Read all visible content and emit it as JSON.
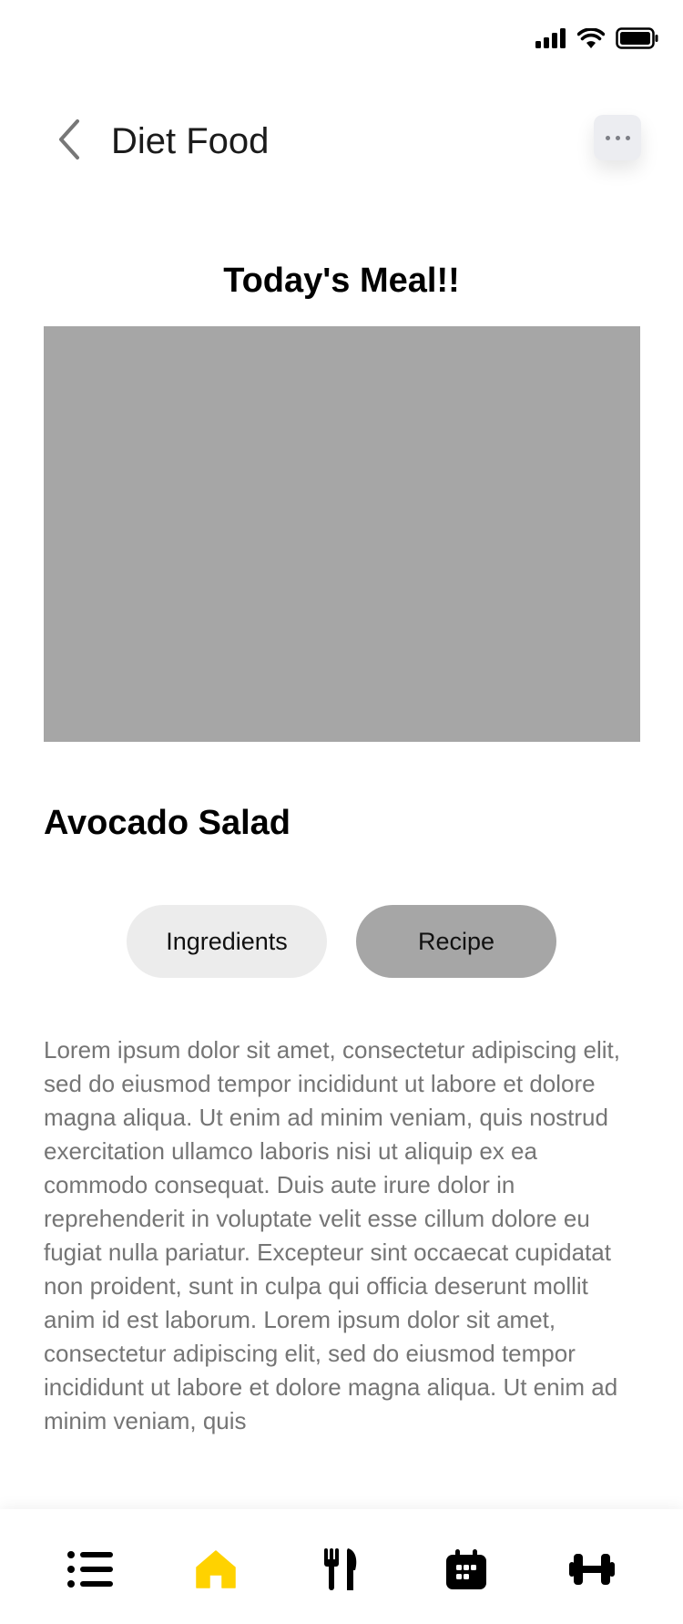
{
  "status_bar": {
    "icons": [
      "signal-icon",
      "wifi-icon",
      "battery-icon"
    ]
  },
  "header": {
    "title": "Diet Food",
    "back_icon": "chevron-left-icon",
    "more_icon": "more-icon"
  },
  "section": {
    "heading": "Today's Meal!!"
  },
  "meal": {
    "name": "Avocado Salad",
    "image_color": "#a6a6a6"
  },
  "tabs": [
    {
      "label": "Ingredients",
      "active": false
    },
    {
      "label": "Recipe",
      "active": true
    }
  ],
  "description": "Lorem ipsum dolor sit amet, consectetur adipiscing elit, sed do eiusmod tempor incididunt ut labore et dolore magna aliqua. Ut enim ad minim veniam, quis nostrud exercitation ullamco laboris nisi ut aliquip ex ea commodo consequat. Duis aute irure dolor in reprehenderit in voluptate velit esse cillum dolore eu fugiat nulla pariatur. Excepteur sint occaecat cupidatat non proident, sunt in culpa qui officia deserunt mollit anim id est laborum. Lorem ipsum dolor sit amet, consectetur adipiscing elit, sed do eiusmod tempor incididunt ut labore et dolore magna aliqua. Ut enim ad minim veniam, quis",
  "bottom_nav": {
    "items": [
      {
        "icon": "list-icon",
        "active": false
      },
      {
        "icon": "home-icon",
        "active": true
      },
      {
        "icon": "utensils-icon",
        "active": false
      },
      {
        "icon": "calendar-icon",
        "active": false
      },
      {
        "icon": "dumbbell-icon",
        "active": false
      }
    ],
    "active_color": "#ffd200",
    "inactive_color": "#000000"
  }
}
